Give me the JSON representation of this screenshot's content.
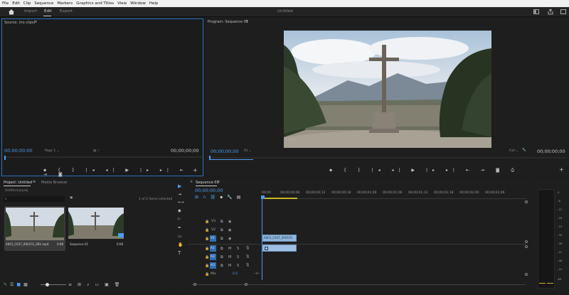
{
  "menu": [
    "File",
    "Edit",
    "Clip",
    "Sequence",
    "Markers",
    "Graphics and Titles",
    "View",
    "Window",
    "Help"
  ],
  "header": {
    "tabs": [
      "Import",
      "Edit",
      "Export"
    ],
    "active_tab": "Edit",
    "title": "Untitled"
  },
  "source": {
    "title": "Source: (no clips)",
    "timecode_left": "00;00;00;00",
    "page": "Page 1",
    "timecode_right": "00;00;00;00"
  },
  "program": {
    "title": "Program: Sequence 01",
    "timecode_left": "00;00;00;00",
    "fit": "Fit",
    "quality": "Full",
    "timecode_right": "00;00;00;00"
  },
  "project": {
    "tab_project": "Project: Untitled",
    "tab_media": "Media Browser",
    "filename": "Untitled.prproj",
    "items_selected": "1 of 2 items selected",
    "items": [
      {
        "name": "A001_C037_0921FG_001.mp4",
        "duration": "0:08"
      },
      {
        "name": "Sequence 01",
        "duration": "0:08"
      }
    ]
  },
  "timeline": {
    "tab": "Sequence 01",
    "timecode": "00;00;00;00",
    "ruler": [
      "00;00",
      "00;00;00;06",
      "00;00;00;12",
      "00;00;00;18",
      "00;00;01;00",
      "00;00;01;06",
      "00;00;01;12",
      "00;00;01;18",
      "00;00;02;00",
      "00;00;02;06"
    ],
    "video_tracks": [
      "V3",
      "V2",
      "V1"
    ],
    "audio_tracks": [
      "A1",
      "A2",
      "A3"
    ],
    "mix_label": "Mix",
    "mix_value": "0.0",
    "clip_name": "A001_C037_0921FG",
    "track_toggle": "V1"
  },
  "meter": {
    "scale": [
      "0",
      "-6",
      "-12",
      "-18",
      "-24",
      "-30",
      "-36",
      "-42",
      "-48",
      "-54",
      "dB"
    ]
  },
  "colors": {
    "accent": "#4c9cf0",
    "clip_video": "#8fb6dd",
    "clip_audio": "#9fbfe4"
  }
}
